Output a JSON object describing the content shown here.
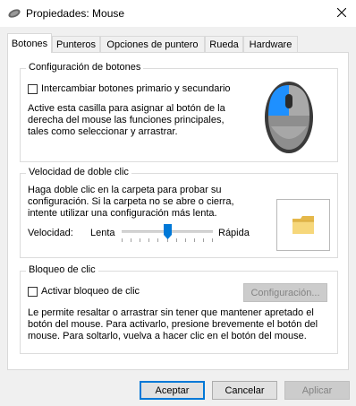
{
  "window": {
    "title": "Propiedades: Mouse"
  },
  "tabs": [
    "Botones",
    "Punteros",
    "Opciones de puntero",
    "Rueda",
    "Hardware"
  ],
  "button_config": {
    "group_label": "Configuración de botones",
    "checkbox_label": "Intercambiar botones primario y secundario",
    "checked": false,
    "desc_lines": [
      "Active esta casilla para asignar al botón de la",
      "derecha del mouse las funciones principales,",
      "tales como seleccionar y arrastrar."
    ]
  },
  "double_click": {
    "group_label": "Velocidad de doble clic",
    "desc_lines": [
      "Haga doble clic en la carpeta para probar su",
      "configuración. Si la carpeta no se abre o cierra,",
      "intente utilizar una configuración más lenta."
    ],
    "speed_label": "Velocidad:",
    "slow_label": "Lenta",
    "fast_label": "Rápida",
    "speed_level": 0.5
  },
  "click_lock": {
    "group_label": "Bloqueo de clic",
    "checkbox_label": "Activar bloqueo de clic",
    "checked": false,
    "settings_button": "Configuración...",
    "desc_lines": [
      "Le permite resaltar o arrastrar sin tener que mantener apretado el",
      "botón del mouse. Para activarlo, presione brevemente el botón del",
      "mouse. Para soltarlo, vuelva a hacer clic en el botón del mouse."
    ]
  },
  "footer": {
    "ok": "Aceptar",
    "cancel": "Cancelar",
    "apply": "Aplicar"
  },
  "icons": {
    "app": "mouse-icon",
    "close": "close-icon",
    "mouse_preview": "mouse-illustration-icon",
    "folder": "folder-icon"
  },
  "colors": {
    "accent": "#0078d7",
    "mouse_highlight": "#1e90ff"
  }
}
